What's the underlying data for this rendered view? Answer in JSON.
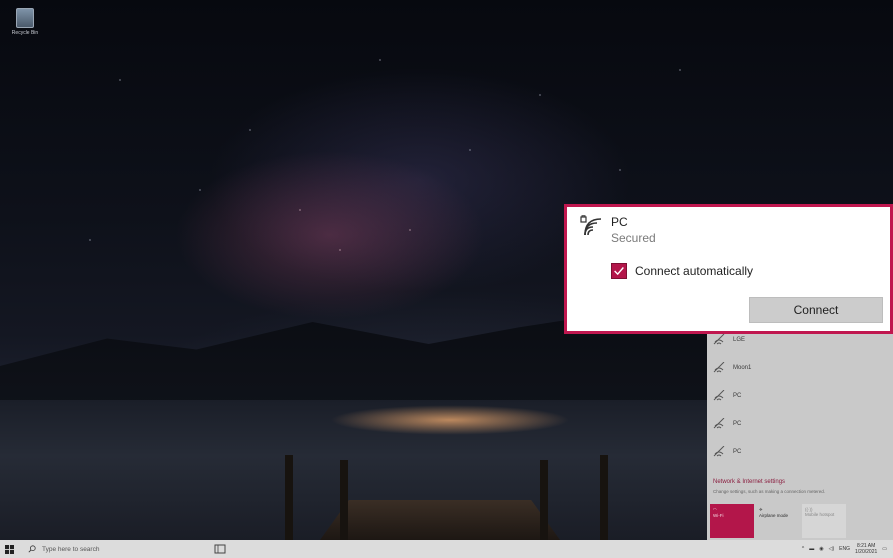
{
  "desktop": {
    "recycle_bin_label": "Recycle Bin"
  },
  "popup": {
    "network_name": "PC",
    "status": "Secured",
    "connect_auto_label": "Connect automatically",
    "connect_auto_checked": true,
    "connect_button": "Connect",
    "accent": "#b3164a",
    "highlight_border": "#c0174f"
  },
  "flyout": {
    "networks": [
      "LGE",
      "Moon1",
      "PC",
      "PC",
      "PC"
    ],
    "settings_link": "Network & Internet settings",
    "settings_desc": "Change settings, such as making a connection metered.",
    "quick_actions": [
      {
        "label": "Wi-Fi",
        "active": true
      },
      {
        "label": "Airplane mode",
        "active": false
      },
      {
        "label": "Mobile hotspot",
        "active": false
      }
    ]
  },
  "taskbar": {
    "search_placeholder": "Type here to search",
    "language": "ENG",
    "time": "8:21 AM",
    "date": "1/20/2021"
  }
}
